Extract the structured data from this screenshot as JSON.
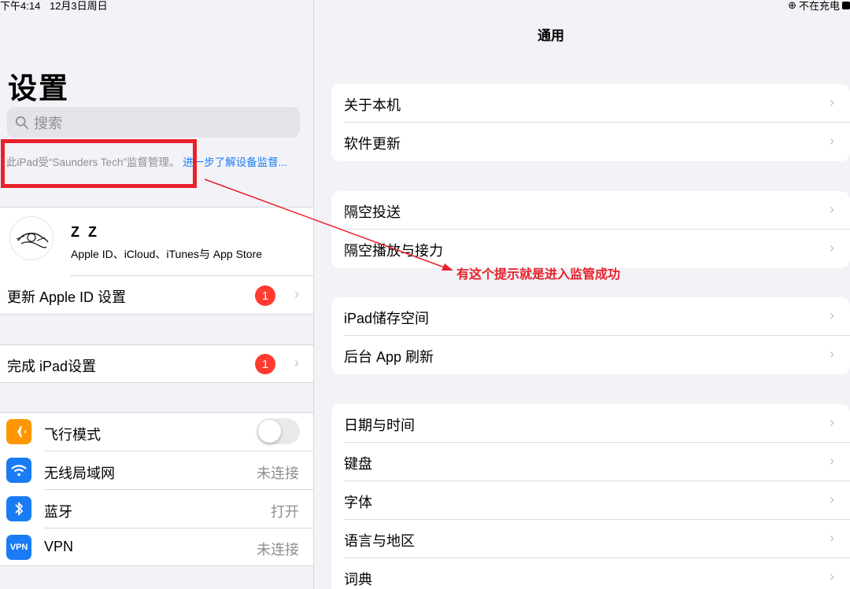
{
  "status": {
    "time": "下午4:14",
    "date": "12月3日周日",
    "charging": "不在充电"
  },
  "sidebar": {
    "title": "设置",
    "search_placeholder": "搜索",
    "supervision_text": "此iPad受“Saunders Tech”监督管理。",
    "supervision_link": "进一步了解设备监督...",
    "profile": {
      "name": "Z Z",
      "subtitle": "Apple ID、iCloud、iTunes与 App Store"
    },
    "update_apple_id": {
      "label": "更新 Apple ID 设置",
      "badge": "1"
    },
    "finish_setup": {
      "label": "完成 iPad设置",
      "badge": "1"
    },
    "settings": [
      {
        "label": "飞行模式",
        "icon": "airplane-icon",
        "color": "#ff9500",
        "value": ""
      },
      {
        "label": "无线局域网",
        "icon": "wifi-icon",
        "color": "#1a7cf5",
        "value": "未连接"
      },
      {
        "label": "蓝牙",
        "icon": "bluetooth-icon",
        "color": "#1a7cf5",
        "value": "打开"
      },
      {
        "label": "VPN",
        "icon": "vpn-icon",
        "color": "#1a7cf5",
        "value": "未连接",
        "icon_text": "VPN"
      }
    ]
  },
  "main": {
    "title": "通用",
    "groups": [
      [
        "关于本机",
        "软件更新"
      ],
      [
        "隔空投送",
        "隔空播放与接力"
      ],
      [
        "iPad储存空间",
        "后台 App 刷新"
      ],
      [
        "日期与时间",
        "键盘",
        "字体",
        "语言与地区",
        "词典"
      ]
    ]
  },
  "annotation": {
    "text": "有这个提示就是进入监管成功",
    "color": "#e8202a"
  }
}
